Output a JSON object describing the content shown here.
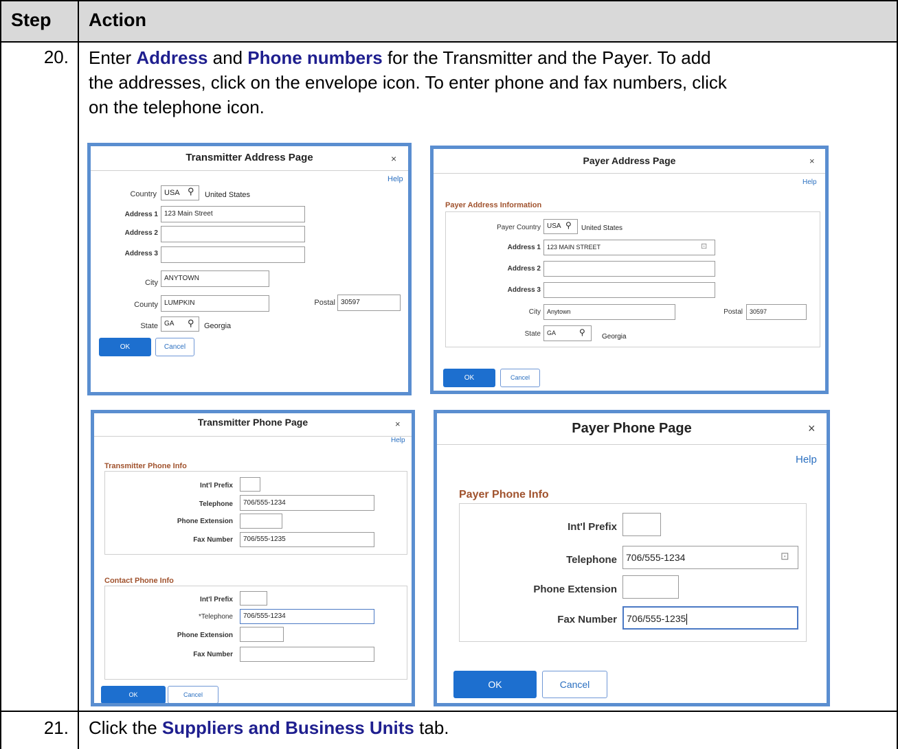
{
  "table": {
    "header_step": "Step",
    "header_action": "Action"
  },
  "rows": [
    {
      "step": "20.",
      "text_1": "Enter ",
      "kw_1": "Address",
      "text_2": " and ",
      "kw_2": "Phone numbers",
      "text_3": " for the Transmitter and the Payer. To add",
      "line_2": "the addresses, click on the envelope icon. To enter phone and fax numbers, click",
      "line_3": "on the telephone icon."
    },
    {
      "step": "21.",
      "text_1": "Click the ",
      "kw_1": "Suppliers and Business Units",
      "text_2": " tab."
    }
  ],
  "transmitter_address": {
    "title": "Transmitter Address Page",
    "close": "×",
    "help": "Help",
    "country_label": "Country",
    "country_value": "USA",
    "country_desc": "United States",
    "address1_label": "Address 1",
    "address1_value": "123 Main Street",
    "address2_label": "Address 2",
    "address3_label": "Address 3",
    "city_label": "City",
    "city_value": "ANYTOWN",
    "county_label": "County",
    "county_value": "LUMPKIN",
    "postal_label": "Postal",
    "postal_value": "30597",
    "state_label": "State",
    "state_value": "GA",
    "state_desc": "Georgia",
    "ok": "OK",
    "cancel": "Cancel"
  },
  "payer_address": {
    "title": "Payer Address Page",
    "close": "×",
    "help": "Help",
    "section": "Payer Address Information",
    "country_label": "Payer Country",
    "country_value": "USA",
    "country_desc": "United States",
    "address1_label": "Address 1",
    "address1_value": "123 MAIN STREET",
    "address2_label": "Address 2",
    "address3_label": "Address 3",
    "city_label": "City",
    "city_value": "Anytown",
    "postal_label": "Postal",
    "postal_value": "30597",
    "state_label": "State",
    "state_value": "GA",
    "state_desc": "Georgia",
    "ok": "OK",
    "cancel": "Cancel"
  },
  "transmitter_phone": {
    "title": "Transmitter Phone Page",
    "close": "×",
    "help": "Help",
    "section1": "Transmitter Phone Info",
    "prefix_label": "Int'l Prefix",
    "telephone_label": "Telephone",
    "telephone_value": "706/555-1234",
    "extension_label": "Phone Extension",
    "fax_label": "Fax Number",
    "fax_value": "706/555-1235",
    "section2": "Contact Phone Info",
    "c_prefix_label": "Int'l Prefix",
    "c_telephone_label": "*Telephone",
    "c_telephone_value": "706/555-1234",
    "c_extension_label": "Phone Extension",
    "c_fax_label": "Fax Number",
    "ok": "OK",
    "cancel": "Cancel"
  },
  "payer_phone": {
    "title": "Payer Phone Page",
    "close": "×",
    "help": "Help",
    "section": "Payer Phone Info",
    "prefix_label": "Int'l Prefix",
    "telephone_label": "Telephone",
    "telephone_value": "706/555-1234",
    "extension_label": "Phone Extension",
    "fax_label": "Fax Number",
    "fax_value": "706/555-1235",
    "ok": "OK",
    "cancel": "Cancel"
  },
  "icons": {
    "magnifier": "search-icon",
    "detail": "detail-icon",
    "close": "close-icon"
  },
  "colors": {
    "header_bg": "#d9d9d9",
    "keyword": "#1f1f8f",
    "frame": "#5a8ed0",
    "ok_button": "#1d6fcf",
    "section_title": "#a0522d",
    "help_link": "#2a6fc0"
  }
}
